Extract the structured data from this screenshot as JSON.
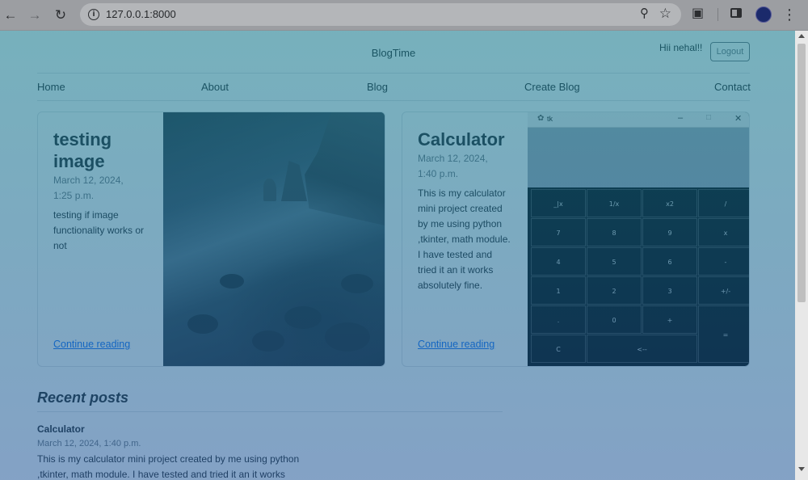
{
  "browser": {
    "url": "127.0.0.1:8000",
    "icons": [
      "back-arrow-icon",
      "forward-arrow-icon",
      "reload-icon",
      "info-icon",
      "zoom-icon",
      "star-icon",
      "extensions-icon",
      "side-panel-icon",
      "profile-avatar",
      "more-menu-icon"
    ]
  },
  "header": {
    "title": "BlogTime",
    "greeting": "Hii nehal!!",
    "logout_label": "Logout"
  },
  "nav": {
    "items": [
      {
        "label": "Home"
      },
      {
        "label": "About"
      },
      {
        "label": "Blog"
      },
      {
        "label": "Create Blog"
      },
      {
        "label": "Contact"
      }
    ]
  },
  "cards": [
    {
      "title_line1": "testing",
      "title_line2": "image",
      "date_line1": "March 12, 2024,",
      "date_line2": "1:25 p.m.",
      "text": "testing if image functionality works or not",
      "link": "Continue reading"
    },
    {
      "title_line1": "Calculator",
      "title_line2": "",
      "date_line1": "March 12, 2024,",
      "date_line2": "1:40 p.m.",
      "text": "This is my calculator mini project created by me using python ,tkinter, math module. I have tested and tried it an it works absolutely fine.",
      "link": "Continue reading"
    }
  ],
  "calculator": {
    "window_title": "tk",
    "keys": [
      "_|x",
      "1/x",
      "x2",
      "/",
      "7",
      "8",
      "9",
      "x",
      "4",
      "5",
      "6",
      "-",
      "1",
      "2",
      "3",
      "+/-",
      ".",
      "0",
      "+",
      "=",
      "C",
      "<--"
    ]
  },
  "recent": {
    "heading": "Recent posts",
    "post_title": "Calculator",
    "post_date": "March 12, 2024, 1:40 p.m.",
    "post_text": "This is my calculator mini project created by me using python ,tkinter, math module. I have tested and tried it an it works"
  }
}
